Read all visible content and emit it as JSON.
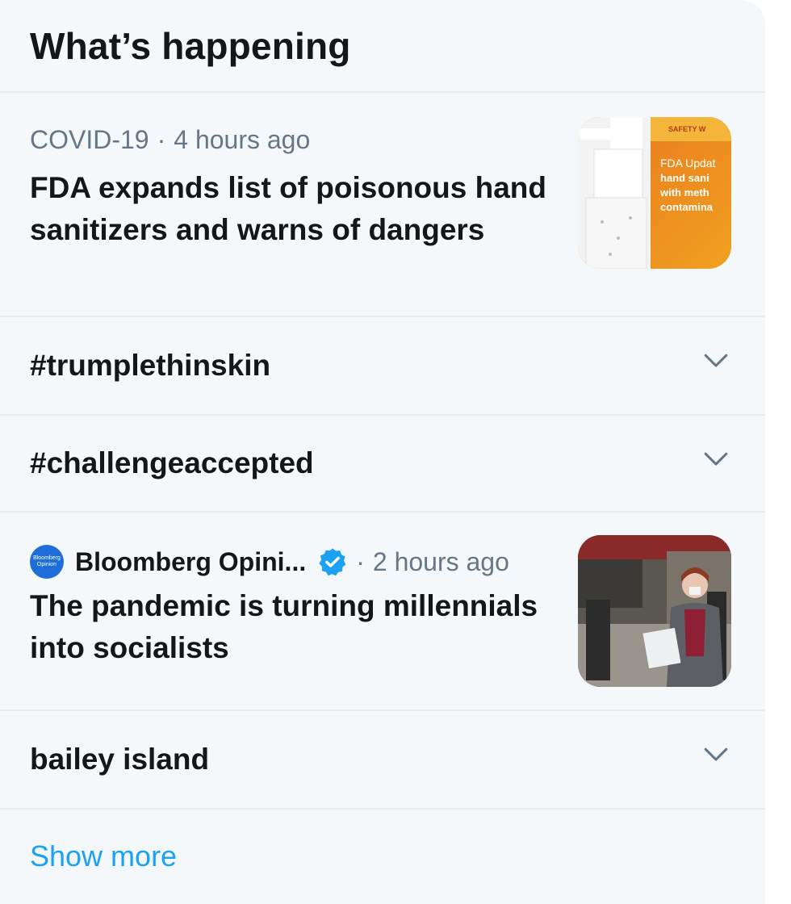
{
  "header": {
    "title": "What’s happening"
  },
  "trend_news_1": {
    "category": "COVID-19",
    "separator": "·",
    "time": "4 hours ago",
    "headline": "FDA expands list of poisonous hand sanitizers and warns of dangers",
    "thumbnail": {
      "banner_text": "SAFETY W",
      "lines": [
        "FDA Updat",
        "hand sani",
        "with meth",
        "contamina"
      ]
    }
  },
  "trend_1": {
    "label": "#trumplethinskin"
  },
  "trend_2": {
    "label": "#challengeaccepted"
  },
  "trend_news_2": {
    "source": "Bloomberg Opini...",
    "avatar_text": "Bloomberg Opinion",
    "separator": "·",
    "time": "2 hours ago",
    "headline": "The pandemic is turning millennials into socialists"
  },
  "trend_3": {
    "label": "bailey island"
  },
  "footer": {
    "show_more": "Show more"
  },
  "colors": {
    "accent": "#1da1f2",
    "text_primary": "#14171a",
    "text_secondary": "#657786",
    "panel_bg": "#f5f8fa",
    "divider": "#e6ecf0"
  },
  "icons": {
    "chevron": "chevron-down-icon",
    "verified": "verified-badge-icon"
  }
}
